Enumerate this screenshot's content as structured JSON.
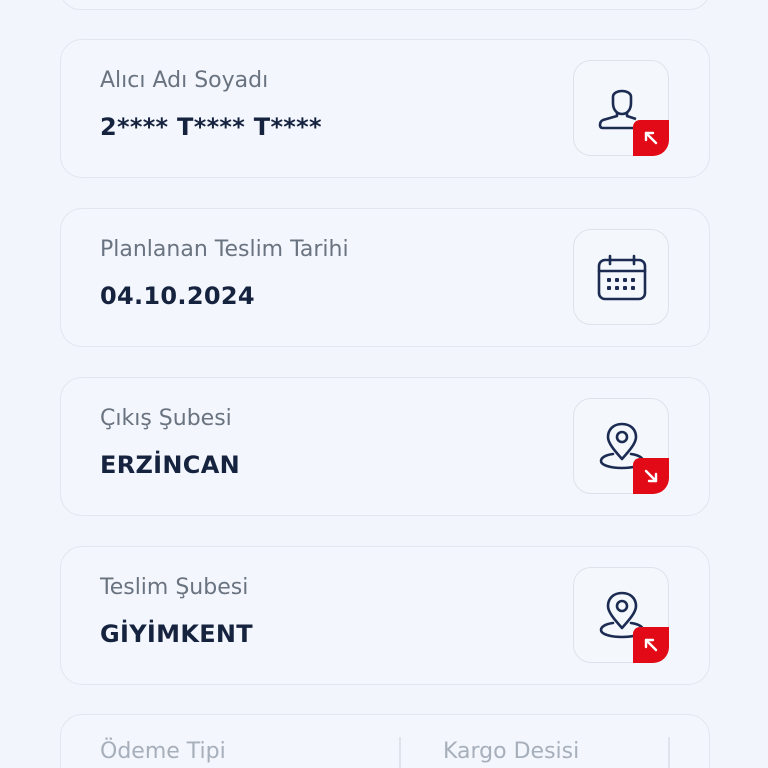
{
  "cards": [
    {
      "label": "Alıcı Adı Soyadı",
      "value": "2**** T**** T****",
      "icon": "user-icon",
      "badge": "arrow-up-left-icon"
    },
    {
      "label": "Planlanan Teslim Tarihi",
      "value": "04.10.2024",
      "icon": "calendar-icon"
    },
    {
      "label": "Çıkış Şubesi",
      "value": "ERZİNCAN",
      "icon": "location-pin-icon",
      "badge": "arrow-down-right-icon"
    },
    {
      "label": "Teslim Şubesi",
      "value": "GİYİMKENT",
      "icon": "location-pin-icon",
      "badge": "arrow-up-left-icon"
    }
  ],
  "bottom_card": {
    "payment_type_label": "Ödeme Tipi",
    "cargo_desi_label": "Kargo Desisi"
  },
  "colors": {
    "accent_red": "#e30a17",
    "icon_navy": "#1b2b52",
    "text_dark": "#16233f",
    "text_muted": "#6a7380",
    "background": "#f2f5fb"
  }
}
